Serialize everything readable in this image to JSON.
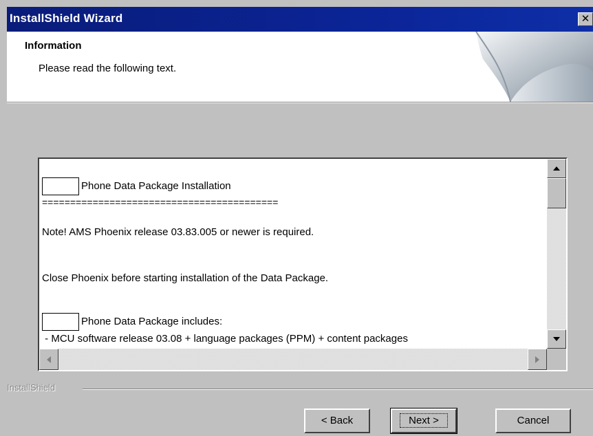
{
  "window": {
    "title": "InstallShield Wizard",
    "close_glyph": "✕"
  },
  "header": {
    "title": "Information",
    "subtitle": "Please read the following text."
  },
  "textbox": {
    "lines": [
      "Phone Data Package Installation",
      "==========================================",
      "Note! AMS Phoenix release 03.83.005 or newer is required.",
      "Close Phoenix before starting installation of the Data Package.",
      "Phone Data Package includes:",
      " - MCU software release 03.08 + language packages (PPM) + content packages"
    ]
  },
  "footer": {
    "brand": "InstallShield",
    "back_label": "< Back",
    "next_label": "Next >",
    "cancel_label": "Cancel"
  }
}
